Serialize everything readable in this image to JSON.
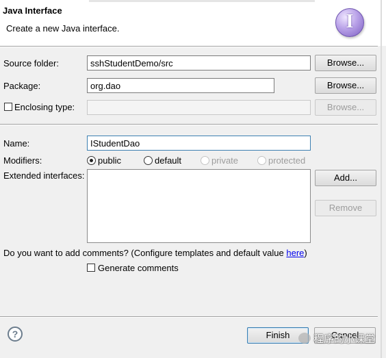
{
  "header": {
    "title": "Java Interface",
    "subtitle": "Create a new Java interface.",
    "icon": "interface-wizard-icon"
  },
  "form": {
    "source_folder": {
      "label": "Source folder:",
      "value": "sshStudentDemo/src",
      "browse_label": "Browse..."
    },
    "package": {
      "label": "Package:",
      "value": "org.dao",
      "browse_label": "Browse..."
    },
    "enclosing_type": {
      "label": "Enclosing type:",
      "checked": false,
      "value": "",
      "browse_label": "Browse..."
    },
    "name": {
      "label": "Name:",
      "value": "IStudentDao"
    },
    "modifiers": {
      "label": "Modifiers:",
      "options": [
        {
          "label": "public",
          "checked": true,
          "enabled": true
        },
        {
          "label": "default",
          "checked": false,
          "enabled": true
        },
        {
          "label": "private",
          "checked": false,
          "enabled": false
        },
        {
          "label": "protected",
          "checked": false,
          "enabled": false
        }
      ]
    },
    "extended_interfaces": {
      "label": "Extended interfaces:",
      "add_label": "Add...",
      "remove_label": "Remove",
      "items": []
    },
    "comments": {
      "question": "Do you want to add comments? (Configure templates and default value ",
      "link": "here",
      "question_end": ")",
      "generate_label": "Generate comments",
      "checked": false
    }
  },
  "footer": {
    "help_icon": "question-icon",
    "finish_label": "Finish",
    "cancel_label": "Cancel",
    "watermark": "程序的小课堂"
  },
  "colors": {
    "accent": "#3c7fb1",
    "link": "#0000ee"
  }
}
